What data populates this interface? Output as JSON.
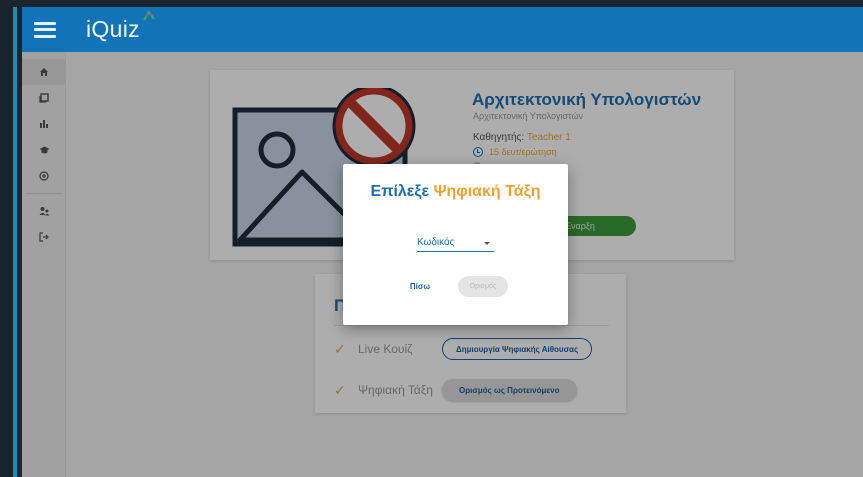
{
  "app": {
    "logo_text": "iQuiz"
  },
  "sidebar": {
    "items": [
      {
        "name": "home-icon",
        "glyph": "⌂",
        "active": true
      },
      {
        "name": "library-icon",
        "glyph": "▤"
      },
      {
        "name": "reports-icon",
        "glyph": "▥"
      },
      {
        "name": "graduation-cap-icon",
        "glyph": "◆"
      },
      {
        "name": "add-circle-icon",
        "glyph": "⊕"
      },
      {
        "name": "users-icon",
        "glyph": "♟"
      },
      {
        "name": "logout-icon",
        "glyph": "↦"
      }
    ]
  },
  "quiz": {
    "title": "Αρχιτεκτονική Υπολογιστών",
    "subtitle": "Αρχιτεκτονική Υπολογιστών",
    "teacher_label": "Καθηγητής:",
    "teacher_value": "Teacher 1",
    "duration": "15 δευτ/ερώτηση",
    "start_button": "Έναρξη"
  },
  "options": {
    "heading": "Π",
    "rows": [
      {
        "label": "Live Κουίζ",
        "button": "Δημιουργία Ψηφιακής Αίθουσας"
      },
      {
        "label": "Ψηφιακή Τάξη",
        "button": "Ορισμός ως Προτεινόμενο"
      }
    ]
  },
  "modal": {
    "title_part1": "Επίλεξε",
    "title_part2": "Ψηφιακή Τάξη",
    "select_placeholder": "Κωδικός",
    "back_button": "Πίσω",
    "submit_button": "Ορισμός"
  },
  "colors": {
    "header": "#1273b8",
    "primary": "#1d6fb0",
    "accent": "#f2a12d",
    "success": "#3c9b3c"
  }
}
